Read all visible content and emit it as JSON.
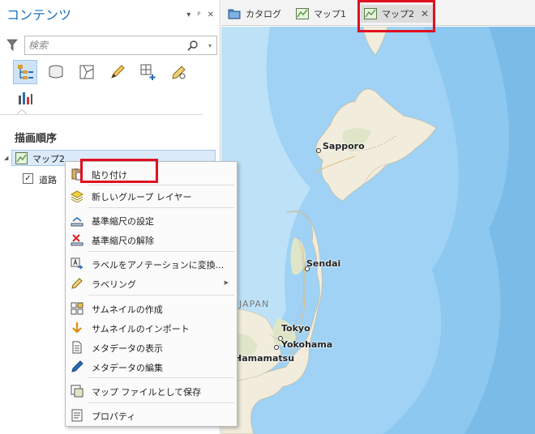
{
  "pane": {
    "title": "コンテンツ",
    "controls": [
      "▾",
      "ᵖ",
      "✕"
    ],
    "search_placeholder": "検索",
    "section_title": "描画順序",
    "layers": {
      "map": "マップ2",
      "road": "道路"
    }
  },
  "tabs": [
    {
      "label": "カタログ"
    },
    {
      "label": "マップ1"
    },
    {
      "label": "マップ2",
      "close": "✕"
    }
  ],
  "map": {
    "cities": [
      "Sapporo",
      "Sendai",
      "Tokyo",
      "Yokohama",
      "Hamamatsu"
    ],
    "country": "JAPAN"
  },
  "menu": {
    "paste": "貼り付け",
    "new_group_layer": "新しいグループ レイヤー",
    "set_ref_scale": "基準縮尺の設定",
    "clear_ref_scale": "基準縮尺の解除",
    "convert_labels": "ラベルをアノテーションに変換...",
    "labeling": "ラベリング",
    "create_thumb": "サムネイルの作成",
    "import_thumb": "サムネイルのインポート",
    "view_metadata": "メタデータの表示",
    "edit_metadata": "メタデータの編集",
    "save_mapfile": "マップ ファイルとして保存",
    "properties": "プロパティ"
  },
  "colors": {
    "accent": "#1a6eb6",
    "highlight": "#e01020",
    "sea": "#9fd2f4",
    "land": "#f1ecdc"
  }
}
